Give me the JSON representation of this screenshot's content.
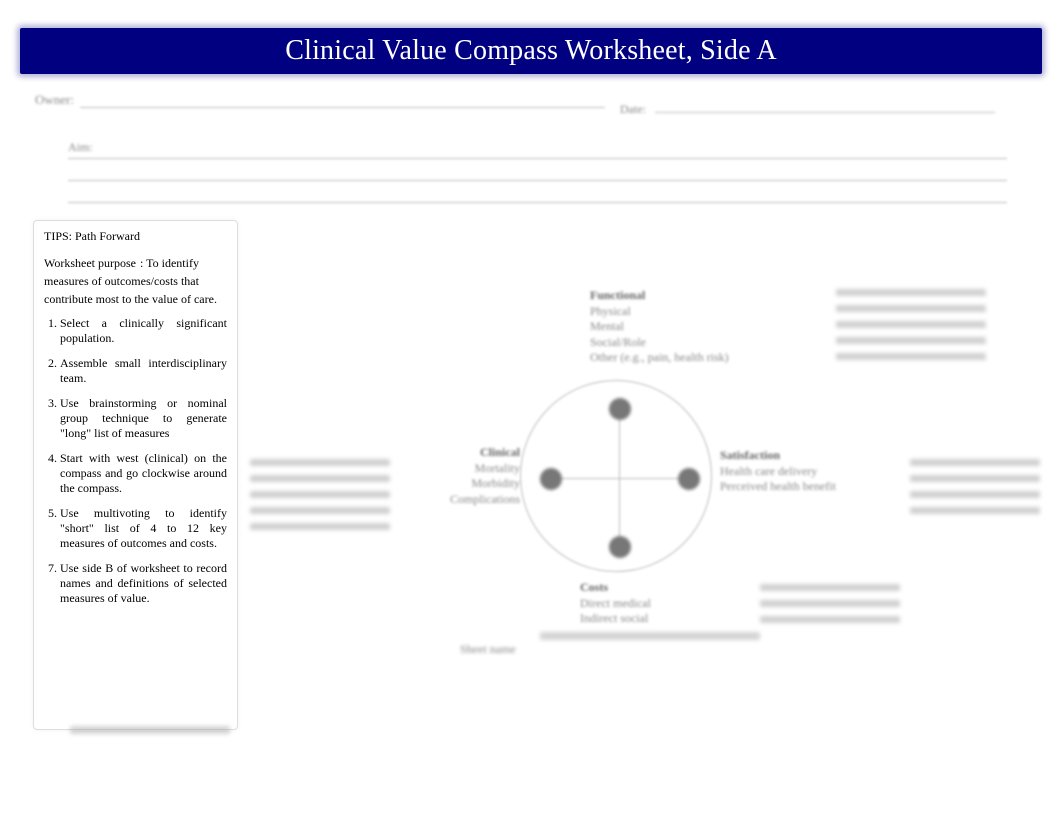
{
  "title": "Clinical Value Compass Worksheet, Side A",
  "header": {
    "owner_label": "Owner:",
    "date_label": "Date:",
    "aim_label": "Aim:",
    "aim_text": ""
  },
  "panel": {
    "title": "TIPS: Path Forward",
    "purpose_label": "Worksheet purpose",
    "purpose_text": ": To identify measures of outcomes/costs that contribute most to the value of care.",
    "steps": [
      "Select a clinically significant population.",
      "Assemble small interdisciplinary team.",
      "Use brainstorming or nominal group technique to generate \"long\" list of measures",
      "Start with west (clinical) on the compass and go clockwise around the compass.",
      "Use multivoting to identify \"short\" list of 4 to 12 key measures of outcomes and costs.",
      "",
      "Use side B of worksheet to record names and definitions of selected measures of value."
    ]
  },
  "compass": {
    "north": {
      "heading": "Functional",
      "items": [
        "Physical",
        "Mental",
        "Social/Role",
        "Other (e.g., pain, health risk)"
      ]
    },
    "west": {
      "heading": "Clinical",
      "items": [
        "Mortality",
        "Morbidity",
        "Complications"
      ]
    },
    "east": {
      "heading": "Satisfaction",
      "items": [
        "Health care delivery",
        "Perceived health benefit"
      ]
    },
    "south": {
      "heading": "Costs",
      "items": [
        "Direct medical",
        "Indirect social"
      ]
    }
  },
  "footer": {
    "corner": "Sheet name"
  }
}
